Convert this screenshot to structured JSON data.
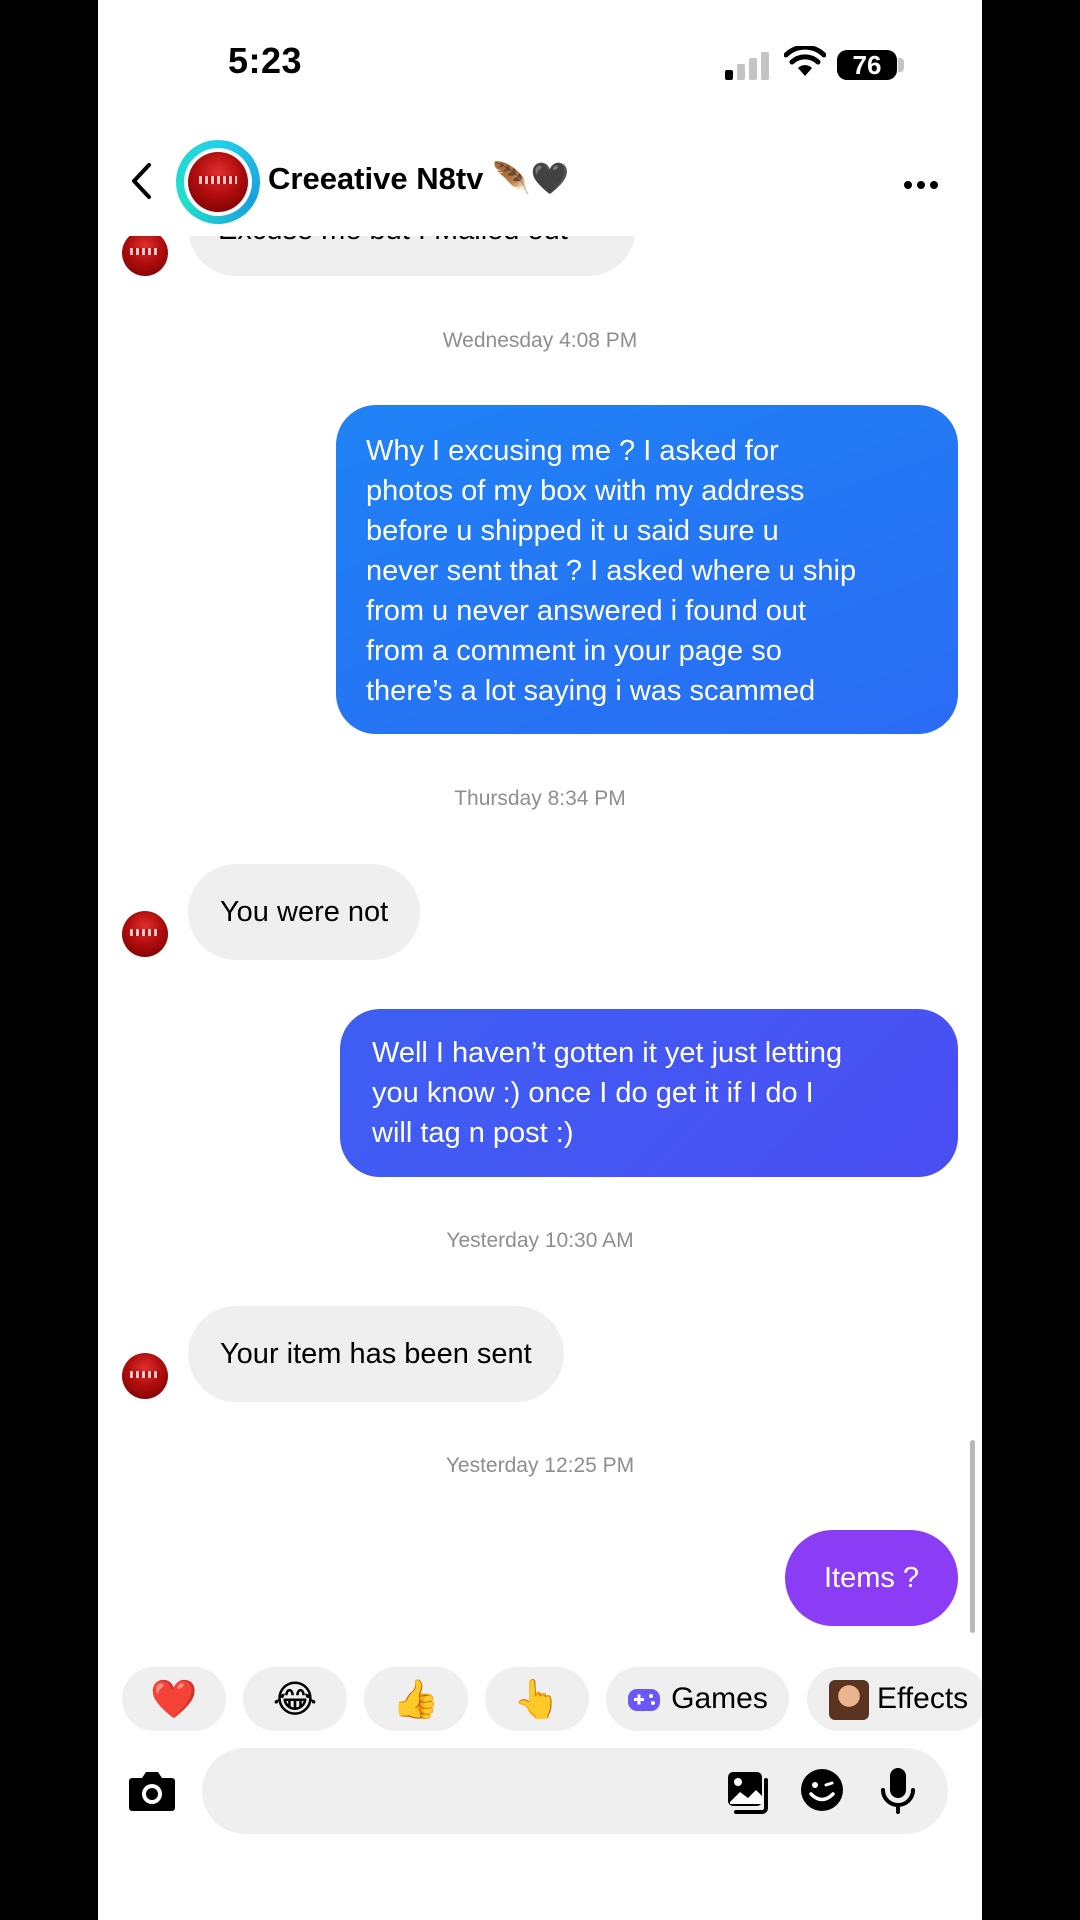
{
  "status_bar": {
    "time": "5:23",
    "battery": "76"
  },
  "header": {
    "contact_name": "Creeative N8tv 🪶🖤"
  },
  "messages": {
    "partial_incoming": "Excuse me but I Mailed out",
    "timestamp_1": "Wednesday 4:08 PM",
    "outgoing_1": [
      "Why I excusing me ? I asked for",
      "photos of my box with my address",
      "before u shipped it u said sure u",
      "never sent that ? I asked where u ship",
      "from u never answered i found out",
      "from a comment in your page so",
      "there’s a lot saying i was scammed"
    ],
    "timestamp_2": "Thursday 8:34 PM",
    "incoming_1": "You were not",
    "outgoing_2": [
      "Well I haven’t gotten it yet just letting",
      "you know :) once I do get it if I do I",
      "will tag n post :)"
    ],
    "timestamp_3": "Yesterday 10:30 AM",
    "incoming_2": "Your item has been sent",
    "timestamp_4": "Yesterday 12:25 PM",
    "outgoing_3": "Items ?"
  },
  "quick_reactions": {
    "heart": "❤️",
    "joy": "😂",
    "thumbs_up": "👍",
    "point": "👆",
    "games_label": "Games",
    "effects_label": "Effects"
  },
  "colors": {
    "outgoing_blue": "#1f82f5",
    "outgoing_indigo": "#4b4ef3",
    "outgoing_purple": "#8b3cf5",
    "incoming_gray": "#efefef"
  }
}
